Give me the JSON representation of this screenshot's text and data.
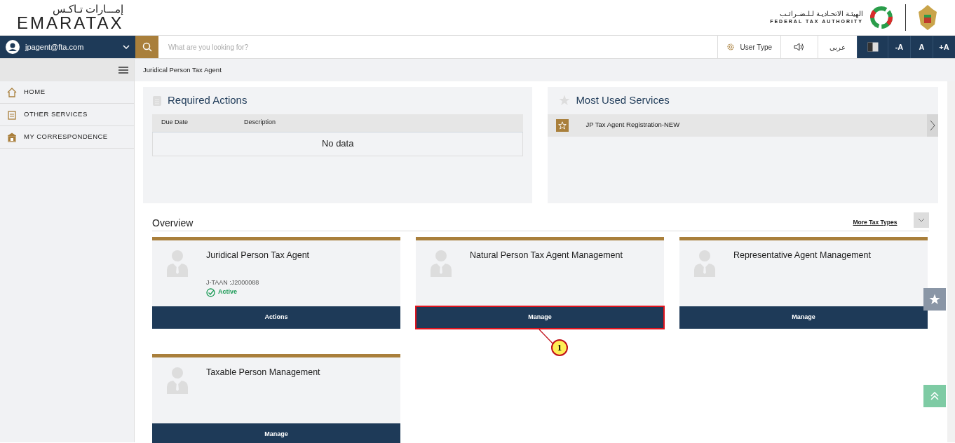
{
  "header": {
    "logo_arabic": "إمـــارات تـاكـس",
    "logo_text": "EMARATAX",
    "authority_arabic": "الهيئـة الاتحـاديـة لـلـضـرائـب",
    "authority_english": "FEDERAL TAX AUTHORITY"
  },
  "user": {
    "email": "jpagent@fta.com"
  },
  "search": {
    "placeholder": "What are you looking for?"
  },
  "toolbar": {
    "user_type": "User Type",
    "language": "عربي",
    "font_buttons": [
      "-A",
      "A",
      "+A"
    ]
  },
  "breadcrumb": "Juridical Person Tax Agent",
  "sidebar": {
    "items": [
      {
        "label": "HOME"
      },
      {
        "label": "OTHER SERVICES"
      },
      {
        "label": "MY CORRESPONDENCE"
      }
    ]
  },
  "required_actions": {
    "title": "Required Actions",
    "columns": [
      "Due Date",
      "Description"
    ],
    "empty_text": "No data"
  },
  "most_used": {
    "title": "Most Used Services",
    "items": [
      {
        "label": "JP Tax Agent Registration-NEW"
      }
    ]
  },
  "overview": {
    "title": "Overview",
    "more_link": "More Tax Types",
    "cards": [
      {
        "title": "Juridical Person Tax Agent",
        "reference": "J-TAAN :J2000088",
        "status": "Active",
        "button": "Actions",
        "highlighted": false
      },
      {
        "title": "Natural Person Tax Agent Management",
        "button": "Manage",
        "highlighted": true
      },
      {
        "title": "Representative Agent Management",
        "button": "Manage",
        "highlighted": false
      },
      {
        "title": "Taxable Person Management",
        "button": "Manage",
        "highlighted": false
      }
    ]
  },
  "callout": {
    "label": "1"
  }
}
